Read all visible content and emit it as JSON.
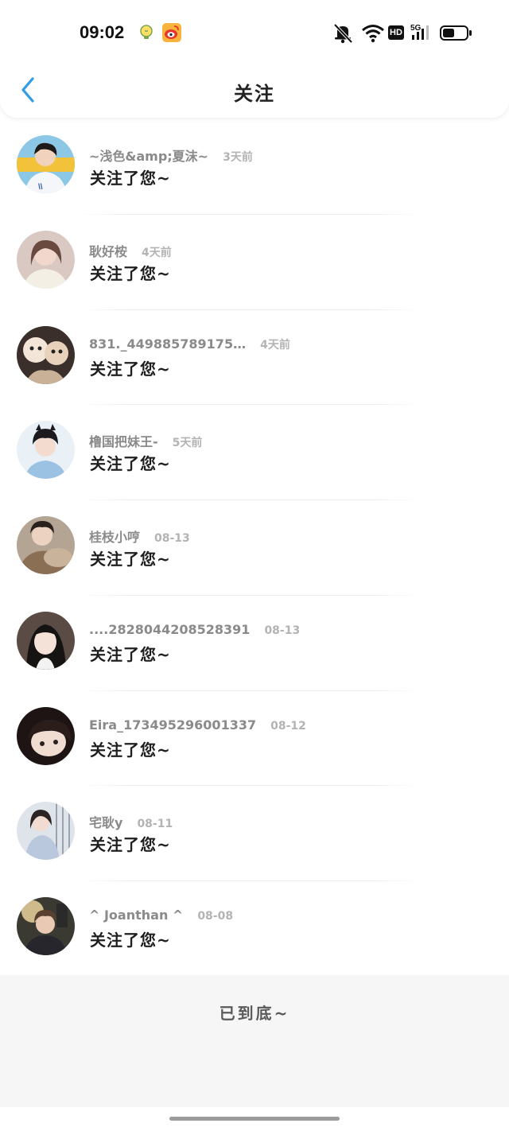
{
  "status_bar": {
    "time": "09:02",
    "notification_icons": [
      "lightbulb-icon",
      "weibo-icon"
    ],
    "right_icons": [
      "mute-bell-icon",
      "wifi-icon",
      "hd-icon",
      "5g-signal-icon",
      "battery-icon"
    ],
    "hd_label": "HD",
    "network_label": "5G"
  },
  "header": {
    "title": "关注",
    "back_icon": "chevron-left-icon",
    "accent_color": "#2f9de8"
  },
  "followers": [
    {
      "name": "~浅色&amp;夏沫~",
      "time": "3天前",
      "message": "关注了您~"
    },
    {
      "name": "耿好桉",
      "time": "4天前",
      "message": "关注了您~"
    },
    {
      "name": "831._449885789175…",
      "time": "4天前",
      "message": "关注了您~"
    },
    {
      "name": "橹国把妹王-",
      "time": "5天前",
      "message": "关注了您~"
    },
    {
      "name": "桂枝小哼",
      "time": "08-13",
      "message": "关注了您~"
    },
    {
      "name": "....2828044208528391",
      "time": "08-13",
      "message": "关注了您~"
    },
    {
      "name": "Eira_173495296001337",
      "time": "08-12",
      "message": "关注了您~"
    },
    {
      "name": "宅耿y",
      "time": "08-11",
      "message": "关注了您~"
    },
    {
      "name": "^ Joanthan ^",
      "time": "08-08",
      "message": "关注了您~"
    }
  ],
  "footer": {
    "end_text": "已到底~"
  }
}
